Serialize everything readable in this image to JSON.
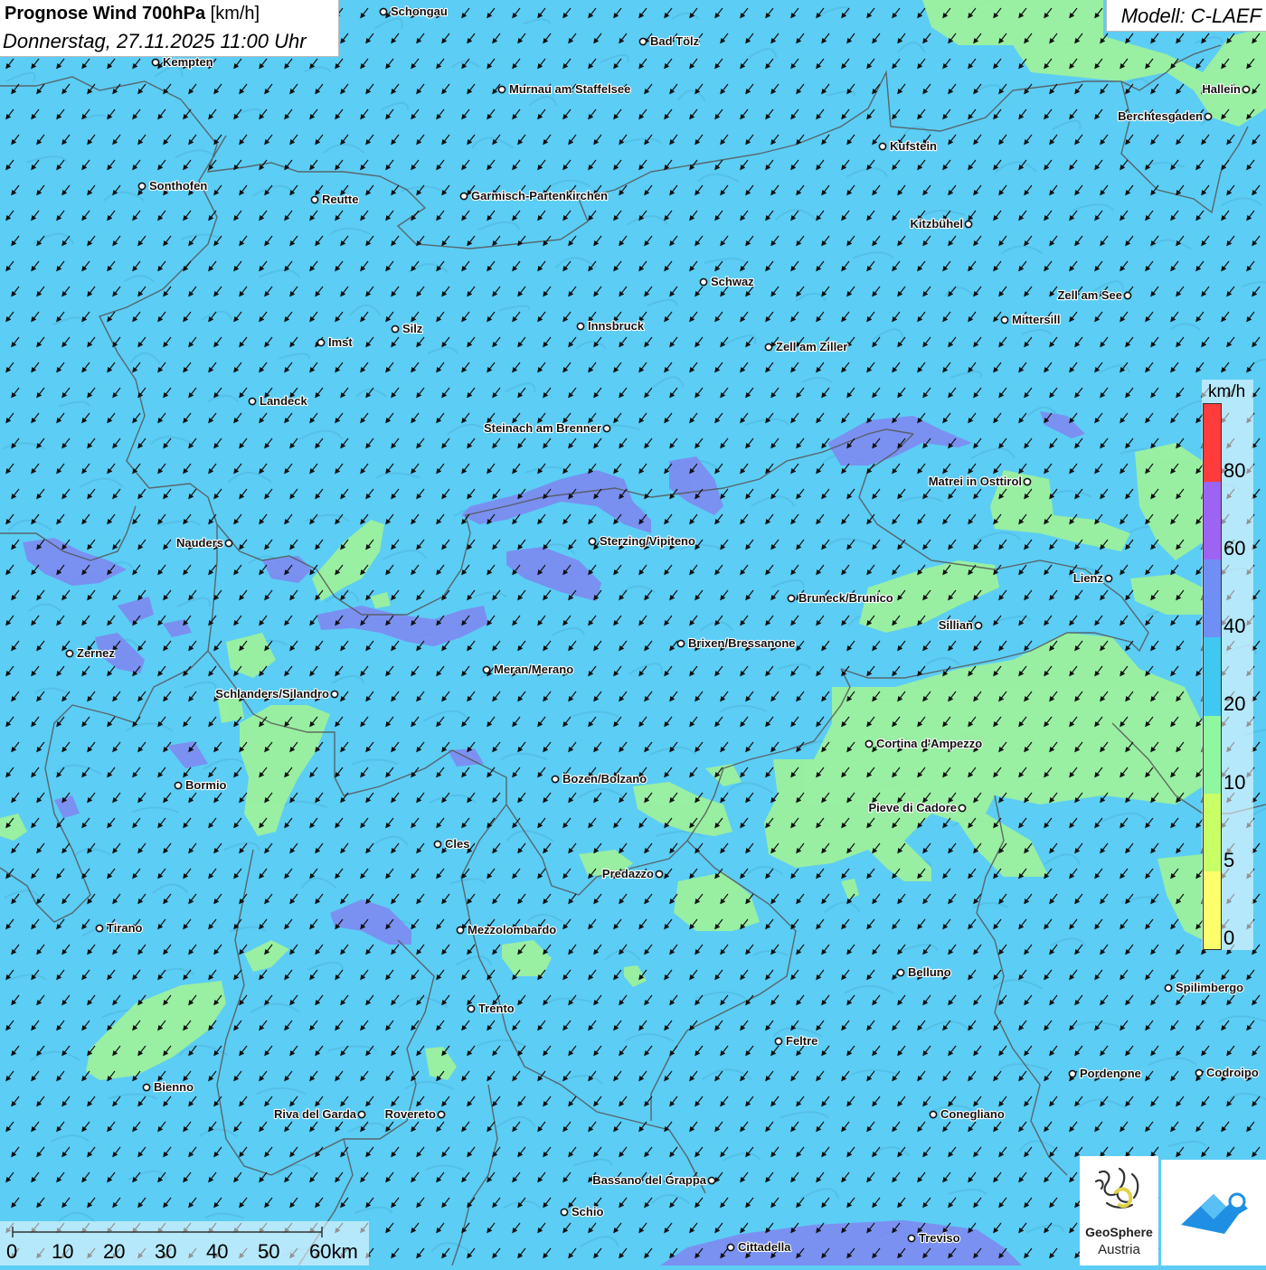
{
  "header": {
    "title_bold": "Prognose Wind 700hPa",
    "title_unit": " [km/h]",
    "datetime": "Donnerstag, 27.11.2025 11:00 Uhr"
  },
  "model": {
    "label": "Modell: C-LAEF"
  },
  "legend": {
    "unit": "km/h",
    "bands": [
      {
        "from": 0,
        "to": 5,
        "color": "#ffff6b"
      },
      {
        "from": 5,
        "to": 10,
        "color": "#c9ff66"
      },
      {
        "from": 10,
        "to": 20,
        "color": "#8ef7a0"
      },
      {
        "from": 20,
        "to": 40,
        "color": "#40c8f0"
      },
      {
        "from": 40,
        "to": 60,
        "color": "#6f8ff5"
      },
      {
        "from": 60,
        "to": 80,
        "color": "#9d63f2"
      },
      {
        "from": 80,
        "to": 100,
        "color": "#ff3b3b"
      }
    ],
    "labels": [
      "80",
      "60",
      "40",
      "20",
      "10",
      "5",
      "0"
    ]
  },
  "scale": {
    "labels": [
      "0",
      "10",
      "20",
      "30",
      "40",
      "50",
      "60km"
    ]
  },
  "logo": {
    "name_line1": "GeoSphere",
    "name_line2": "Austria"
  },
  "colors": {
    "background": "#5ccdf5",
    "low_wind": "#9ef29a",
    "high_wind": "#7f86f0",
    "arrow": "#111111",
    "border": "#555555"
  },
  "wind": {
    "direction": "NE",
    "arrow_rows": 50,
    "arrow_cols": 50
  },
  "cities": [
    {
      "name": "Schongau",
      "side": "right"
    },
    {
      "name": "Bad Tölz",
      "side": "right"
    },
    {
      "name": "Kempten",
      "side": "right"
    },
    {
      "name": "Murnau am Staffelsee",
      "side": "right"
    },
    {
      "name": "Hallein",
      "side": "left"
    },
    {
      "name": "Berchtesgaden",
      "side": "left"
    },
    {
      "name": "Kufstein",
      "side": "right"
    },
    {
      "name": "Sonthofen",
      "side": "right"
    },
    {
      "name": "Reutte",
      "side": "right"
    },
    {
      "name": "Garmisch-Partenkirchen",
      "side": "right"
    },
    {
      "name": "Kitzbühel",
      "side": "left"
    },
    {
      "name": "Schwaz",
      "side": "right"
    },
    {
      "name": "Zell am See",
      "side": "left"
    },
    {
      "name": "Mittersill",
      "side": "right"
    },
    {
      "name": "Innsbruck",
      "side": "right"
    },
    {
      "name": "Silz",
      "side": "right"
    },
    {
      "name": "Imst",
      "side": "right"
    },
    {
      "name": "Zell am Ziller",
      "side": "right"
    },
    {
      "name": "Landeck",
      "side": "right"
    },
    {
      "name": "Steinach am Brenner",
      "side": "left"
    },
    {
      "name": "Matrei in Osttirol",
      "side": "left"
    },
    {
      "name": "Nauders",
      "side": "left"
    },
    {
      "name": "Sterzing/Vipiteno",
      "side": "right"
    },
    {
      "name": "Lienz",
      "side": "left"
    },
    {
      "name": "Bruneck/Brunico",
      "side": "right"
    },
    {
      "name": "Sillian",
      "side": "left"
    },
    {
      "name": "Zernez",
      "side": "right"
    },
    {
      "name": "Brixen/Bressanone",
      "side": "right"
    },
    {
      "name": "Meran/Merano",
      "side": "right"
    },
    {
      "name": "Schlanders/Silandro",
      "side": "left"
    },
    {
      "name": "Cortina d'Ampezzo",
      "side": "right"
    },
    {
      "name": "Bozen/Bolzano",
      "side": "right"
    },
    {
      "name": "Bormio",
      "side": "right"
    },
    {
      "name": "Pieve di Cadore",
      "side": "left"
    },
    {
      "name": "Cles",
      "side": "right"
    },
    {
      "name": "Predazzo",
      "side": "left"
    },
    {
      "name": "Tirano",
      "side": "right"
    },
    {
      "name": "Mezzolombardo",
      "side": "right"
    },
    {
      "name": "Belluno",
      "side": "right"
    },
    {
      "name": "Spilimbergo",
      "side": "right"
    },
    {
      "name": "Trento",
      "side": "right"
    },
    {
      "name": "Feltre",
      "side": "right"
    },
    {
      "name": "Pordenone",
      "side": "right"
    },
    {
      "name": "Codroipo",
      "side": "right"
    },
    {
      "name": "Bienno",
      "side": "right"
    },
    {
      "name": "Riva del Garda",
      "side": "left"
    },
    {
      "name": "Rovereto",
      "side": "left"
    },
    {
      "name": "Conegliano",
      "side": "right"
    },
    {
      "name": "Bassano del Grappa",
      "side": "left"
    },
    {
      "name": "Schio",
      "side": "right"
    },
    {
      "name": "Treviso",
      "side": "right"
    },
    {
      "name": "Cittadella",
      "side": "right"
    }
  ]
}
